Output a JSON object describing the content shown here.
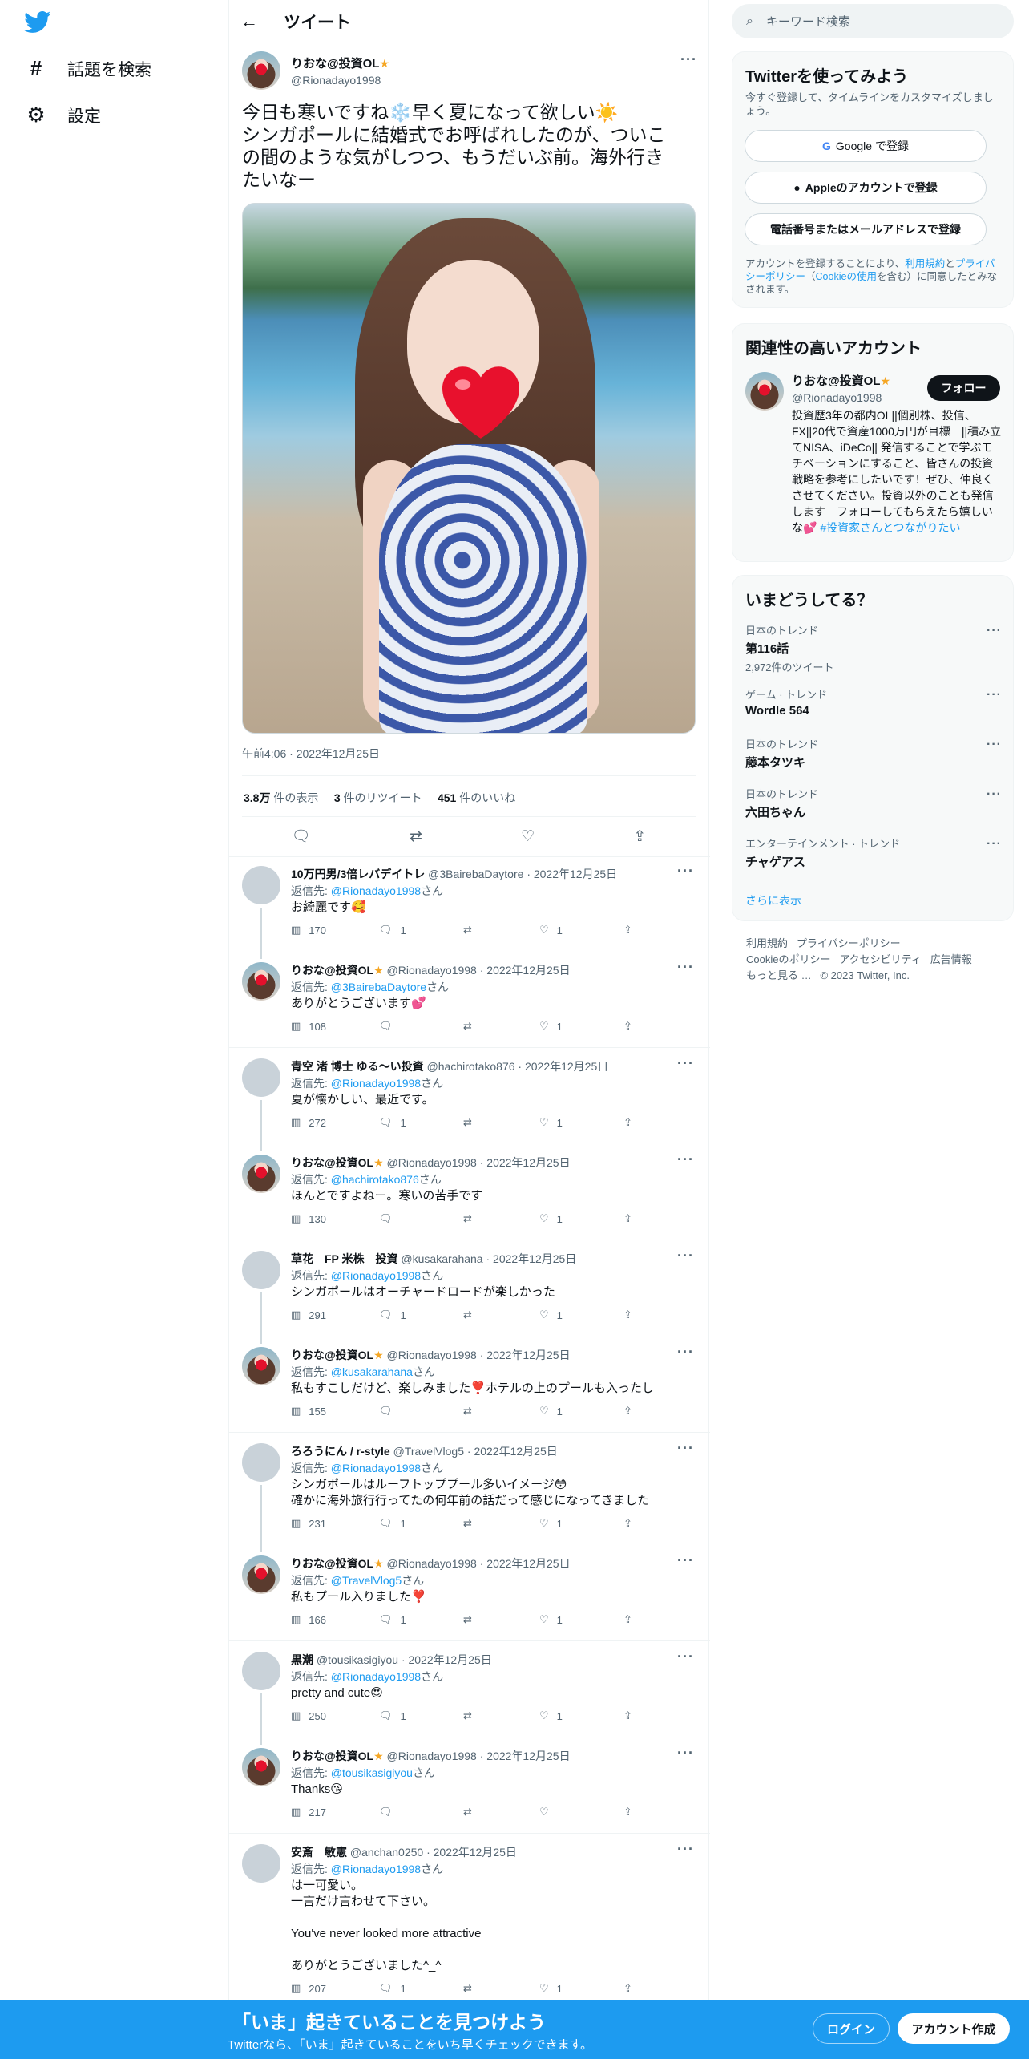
{
  "nav": {
    "explore": "話題を検索",
    "settings": "設定"
  },
  "header": {
    "back": "←",
    "title": "ツイート"
  },
  "tweet": {
    "name": "りおな@投資OL",
    "handle": "@Rionadayo1998",
    "text_lines": [
      "今日も寒いですね❄️早く夏になって欲しい☀️",
      "シンガポールに結婚式でお呼ばれしたのが、ついこ",
      "の間のような気がしつつ、もうだいぶ前。海外行き",
      "たいなー"
    ],
    "time": "午前4:06 · 2022年12月25日",
    "views_num": "3.8万",
    "views_label": "件の表示",
    "rt_num": "3",
    "rt_label": "件のリツイート",
    "likes_num": "451",
    "likes_label": "件のいいね"
  },
  "replies": [
    {
      "name": "10万円男/3倍レバデイトレ",
      "handle": "@3BairebaDaytore",
      "date": "· 2022年12月25日",
      "to_label": "返信先: ",
      "to": "@Rionadayo1998",
      "to_suffix": "さん",
      "text": [
        "お綺麗です🥰"
      ],
      "views": "170",
      "rep": "1",
      "rt": "",
      "like": "1",
      "me": false
    },
    {
      "name": "りおな@投資OL",
      "handle": "@Rionadayo1998",
      "date": "· 2022年12月25日",
      "to_label": "返信先: ",
      "to": "@3BairebaDaytore",
      "to_suffix": "さん",
      "text": [
        "ありがとうございます💕"
      ],
      "views": "108",
      "rep": "",
      "rt": "",
      "like": "1",
      "me": true
    },
    {
      "name": "青空 渚 博士 ゆる～い投資",
      "handle": "@hachirotako876",
      "date": "· 2022年12月25日",
      "to_label": "返信先: ",
      "to": "@Rionadayo1998",
      "to_suffix": "さん",
      "text": [
        "夏が懐かしい、最近です。"
      ],
      "views": "272",
      "rep": "1",
      "rt": "",
      "like": "1",
      "me": false
    },
    {
      "name": "りおな@投資OL",
      "handle": "@Rionadayo1998",
      "date": "· 2022年12月25日",
      "to_label": "返信先: ",
      "to": "@hachirotako876",
      "to_suffix": "さん",
      "text": [
        "ほんとですよねー。寒いの苦手です"
      ],
      "views": "130",
      "rep": "",
      "rt": "",
      "like": "1",
      "me": true
    },
    {
      "name": "草花　FP 米株　投資",
      "handle": "@kusakarahana",
      "date": "· 2022年12月25日",
      "to_label": "返信先: ",
      "to": "@Rionadayo1998",
      "to_suffix": "さん",
      "text": [
        "シンガポールはオーチャードロードが楽しかった"
      ],
      "views": "291",
      "rep": "1",
      "rt": "",
      "like": "1",
      "me": false
    },
    {
      "name": "りおな@投資OL",
      "handle": "@Rionadayo1998",
      "date": "· 2022年12月25日",
      "to_label": "返信先: ",
      "to": "@kusakarahana",
      "to_suffix": "さん",
      "text": [
        "私もすこしだけど、楽しみました❣️ホテルの上のプールも入ったし"
      ],
      "views": "155",
      "rep": "",
      "rt": "",
      "like": "1",
      "me": true
    },
    {
      "name": "ろろうにん / r-style",
      "handle": "@TravelVlog5",
      "date": "· 2022年12月25日",
      "to_label": "返信先: ",
      "to": "@Rionadayo1998",
      "to_suffix": "さん",
      "text": [
        "シンガポールはルーフトッププール多いイメージ😳",
        "確かに海外旅行行ってたの何年前の話だって感じになってきました"
      ],
      "views": "231",
      "rep": "1",
      "rt": "",
      "like": "1",
      "me": false
    },
    {
      "name": "りおな@投資OL",
      "handle": "@Rionadayo1998",
      "date": "· 2022年12月25日",
      "to_label": "返信先: ",
      "to": "@TravelVlog5",
      "to_suffix": "さん",
      "text": [
        "私もプール入りました❣️"
      ],
      "views": "166",
      "rep": "1",
      "rt": "",
      "like": "1",
      "me": true
    },
    {
      "name": "黒潮",
      "handle": "@tousikasigiyou",
      "date": "· 2022年12月25日",
      "to_label": "返信先: ",
      "to": "@Rionadayo1998",
      "to_suffix": "さん",
      "text": [
        "pretty and cute😍"
      ],
      "views": "250",
      "rep": "1",
      "rt": "",
      "like": "1",
      "me": false
    },
    {
      "name": "りおな@投資OL",
      "handle": "@Rionadayo1998",
      "date": "· 2022年12月25日",
      "to_label": "返信先: ",
      "to": "@tousikasigiyou",
      "to_suffix": "さん",
      "text": [
        "Thanks😘"
      ],
      "views": "217",
      "rep": "",
      "rt": "",
      "like": "",
      "me": true
    },
    {
      "name": "安斎　敏憲",
      "handle": "@anchan0250",
      "date": "· 2022年12月25日",
      "to_label": "返信先: ",
      "to": "@Rionadayo1998",
      "to_suffix": "さん",
      "text": [
        "は一可愛い。",
        "一言だけ言わせて下さい。",
        "",
        "You've never looked more attractive",
        "",
        "ありがとうございました^_^"
      ],
      "views": "207",
      "rep": "1",
      "rt": "",
      "like": "1",
      "me": false
    }
  ],
  "side": {
    "search_placeholder": "キーワード検索",
    "signup_title": "Twitterを使ってみよう",
    "signup_sub": "今すぐ登録して、タイムラインをカスタマイズしましょう。",
    "google": "Google で登録",
    "apple": "Appleのアカウントで登録",
    "phone": "電話番号またはメールアドレスで登録",
    "terms_1": "アカウントを登録することにより、",
    "terms_link1": "利用規約",
    "terms_2": "と",
    "terms_link2": "プライバシーポリシー",
    "terms_3": "（",
    "terms_link3": "Cookieの使用",
    "terms_4": "を含む）に同意したとみなされます。",
    "rel_title": "関連性の高いアカウント",
    "rel_name": "りおな@投資OL",
    "rel_handle": "@Rionadayo1998",
    "follow": "フォロー",
    "rel_bio": "投資歴3年の都内OL||個別株、投信、FX||20代で資産1000万円が目標　||積み立てNISA、iDeCo|| 発信することで学ぶモチベーションにすること、皆さんの投資戦略を参考にしたいです！ぜひ、仲良くさせてください。投資以外のことも発信します　フォローしてもらえたら嬉しいな💕",
    "rel_tag": "#投資家さんとつながりたい",
    "trends_title": "いまどうしてる？",
    "trends": [
      {
        "cat": "日本のトレンド",
        "t": "第116話",
        "c": "2,972件のツイート"
      },
      {
        "cat": "ゲーム · トレンド",
        "t": "Wordle 564",
        "c": ""
      },
      {
        "cat": "日本のトレンド",
        "t": "藤本タツキ",
        "c": ""
      },
      {
        "cat": "日本のトレンド",
        "t": "六田ちゃん",
        "c": ""
      },
      {
        "cat": "エンターテインメント · トレンド",
        "t": "チャゲアス",
        "c": ""
      }
    ],
    "show_more": "さらに表示",
    "footer_links": [
      "利用規約",
      "プライバシーポリシー",
      "Cookieのポリシー",
      "アクセシビリティ",
      "広告情報",
      "もっと見る …",
      "© 2023 Twitter, Inc."
    ]
  },
  "bottom": {
    "big": "「いま」起きていることを見つけよう",
    "small": "Twitterなら、「いま」起きていることをいち早くチェックできます。",
    "login": "ログイン",
    "signup": "アカウント作成"
  },
  "colors": {
    "accent": "#1d9bf0",
    "text": "#0f1419",
    "muted": "#536471"
  }
}
